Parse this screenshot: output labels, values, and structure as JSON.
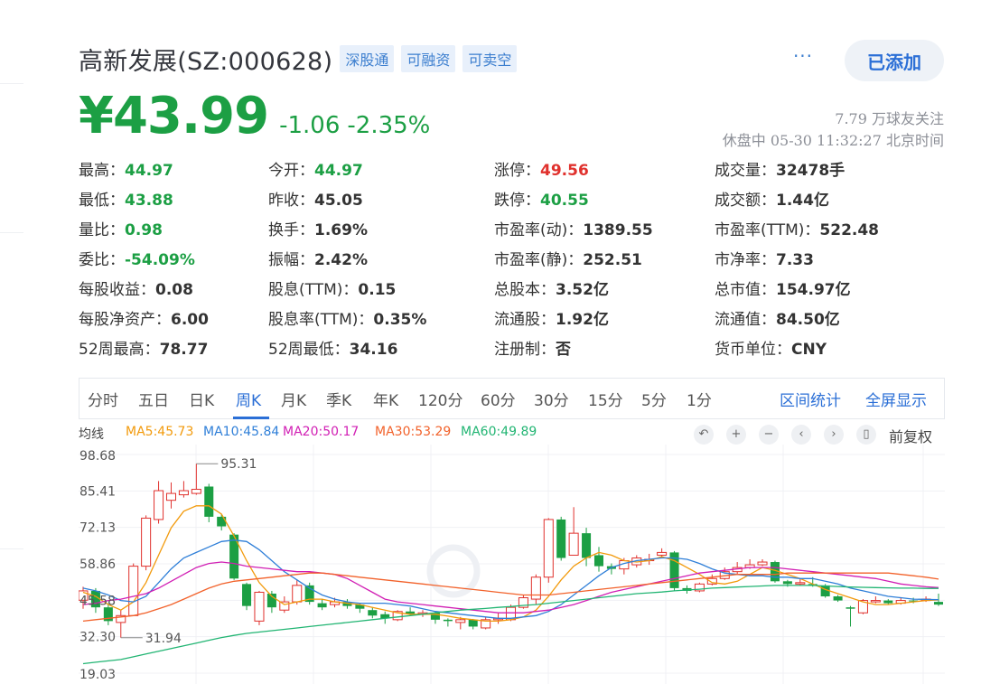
{
  "header": {
    "name": "高新发展(SZ:000628)",
    "tags": [
      "深股通",
      "可融资",
      "可卖空"
    ],
    "more_label": "···",
    "added_label": "已添加"
  },
  "price": {
    "current": "¥43.99",
    "change": "-1.06",
    "change_pct": "-2.35%",
    "followers": "7.79 万球友关注",
    "status": "休盘中 05-30 11:32:27 北京时间"
  },
  "quote": [
    [
      [
        "最高",
        "44.97",
        "green"
      ],
      [
        "今开",
        "44.97",
        "green"
      ],
      [
        "涨停",
        "49.56",
        "red"
      ],
      [
        "成交量",
        "32478手",
        ""
      ]
    ],
    [
      [
        "最低",
        "43.88",
        "green"
      ],
      [
        "昨收",
        "45.05",
        ""
      ],
      [
        "跌停",
        "40.55",
        "green"
      ],
      [
        "成交额",
        "1.44亿",
        ""
      ]
    ],
    [
      [
        "量比",
        "0.98",
        "green"
      ],
      [
        "换手",
        "1.69%",
        ""
      ],
      [
        "市盈率(动)",
        "1389.55",
        ""
      ],
      [
        "市盈率(TTM)",
        "522.48",
        ""
      ]
    ],
    [
      [
        "委比",
        "-54.09%",
        "green"
      ],
      [
        "振幅",
        "2.42%",
        ""
      ],
      [
        "市盈率(静)",
        "252.51",
        ""
      ],
      [
        "市净率",
        "7.33",
        ""
      ]
    ],
    [
      [
        "每股收益",
        "0.08",
        ""
      ],
      [
        "股息(TTM)",
        "0.15",
        ""
      ],
      [
        "总股本",
        "3.52亿",
        ""
      ],
      [
        "总市值",
        "154.97亿",
        ""
      ]
    ],
    [
      [
        "每股净资产",
        "6.00",
        ""
      ],
      [
        "股息率(TTM)",
        "0.35%",
        ""
      ],
      [
        "流通股",
        "1.92亿",
        ""
      ],
      [
        "流通值",
        "84.50亿",
        ""
      ]
    ],
    [
      [
        "52周最高",
        "78.77",
        ""
      ],
      [
        "52周最低",
        "34.16",
        ""
      ],
      [
        "注册制",
        "否",
        ""
      ],
      [
        "货币单位",
        "CNY",
        ""
      ]
    ]
  ],
  "periods": [
    "分时",
    "五日",
    "日K",
    "周K",
    "月K",
    "季K",
    "年K",
    "120分",
    "60分",
    "30分",
    "15分",
    "5分",
    "1分"
  ],
  "active_period": 3,
  "period_links": [
    "区间统计",
    "全屏显示"
  ],
  "ma": {
    "label": "均线",
    "items": [
      {
        "text": "MA5:45.73",
        "color": "#f29a0c"
      },
      {
        "text": "MA10:45.84",
        "color": "#2f7fd8"
      },
      {
        "text": "MA20:50.17",
        "color": "#d11fb4"
      },
      {
        "text": "MA30:53.29",
        "color": "#f2622b"
      },
      {
        "text": "MA60:49.89",
        "color": "#22b573"
      }
    ],
    "fuquan_label": "前复权"
  },
  "controls": [
    {
      "name": "undo-icon",
      "glyph": "↶"
    },
    {
      "name": "zoom-in-icon",
      "glyph": "+"
    },
    {
      "name": "zoom-out-icon",
      "glyph": "−"
    },
    {
      "name": "scroll-left-icon",
      "glyph": "‹"
    },
    {
      "name": "scroll-right-icon",
      "glyph": "›"
    },
    {
      "name": "candle-type-icon",
      "glyph": "▯"
    }
  ],
  "chart_data": {
    "type": "candlestick",
    "y_ticks": [
      "98.68",
      "85.41",
      "72.13",
      "58.86",
      "45.58",
      "32.30",
      "19.03"
    ],
    "y_tick_values": [
      98.68,
      85.41,
      72.13,
      58.86,
      45.58,
      32.3,
      19.03
    ],
    "ylim": [
      19.03,
      98.68
    ],
    "annotations": [
      {
        "text": "95.31",
        "value": 95.31,
        "index": 9
      },
      {
        "text": "31.94",
        "value": 31.94,
        "index": 3
      }
    ],
    "candles": [
      [
        45.6,
        49,
        50.5,
        42.5
      ],
      [
        49,
        43,
        50,
        41
      ],
      [
        43,
        38,
        44.5,
        36.5
      ],
      [
        37.5,
        40,
        42,
        31.94
      ],
      [
        40,
        58,
        59,
        40
      ],
      [
        58,
        75.5,
        76.5,
        56.5
      ],
      [
        75,
        85.5,
        89,
        73.5
      ],
      [
        82,
        84.5,
        88.5,
        79
      ],
      [
        84,
        85.5,
        89,
        83
      ],
      [
        84.5,
        86,
        95.31,
        84
      ],
      [
        87,
        76,
        88,
        74
      ],
      [
        76,
        72.5,
        77,
        71
      ],
      [
        69.5,
        53.5,
        70,
        53
      ],
      [
        51.5,
        43.5,
        52,
        42
      ],
      [
        38,
        48.5,
        49,
        36.5
      ],
      [
        48,
        43,
        49,
        41
      ],
      [
        42,
        45,
        47,
        41
      ],
      [
        45,
        51,
        53,
        44
      ],
      [
        51,
        45,
        52,
        44
      ],
      [
        44.5,
        43,
        46,
        42
      ],
      [
        44,
        45,
        46.5,
        43
      ],
      [
        45,
        43.5,
        46,
        42.5
      ],
      [
        44,
        42.5,
        44.5,
        41
      ],
      [
        42,
        40,
        43,
        39
      ],
      [
        40.5,
        39,
        41.5,
        37
      ],
      [
        38.5,
        41.5,
        42,
        38
      ],
      [
        41.5,
        40.5,
        43,
        40
      ],
      [
        40.5,
        41,
        42,
        39.5
      ],
      [
        41,
        38.5,
        41.5,
        37
      ],
      [
        38.5,
        38,
        39,
        36
      ],
      [
        37.5,
        38.5,
        39.5,
        35
      ],
      [
        38.5,
        36,
        38.8,
        35
      ],
      [
        35.5,
        38.5,
        39.5,
        35
      ],
      [
        38.5,
        39,
        41,
        37
      ],
      [
        38.5,
        43,
        44,
        38
      ],
      [
        43,
        46.5,
        47.5,
        42.5
      ],
      [
        46,
        54,
        55,
        44
      ],
      [
        54,
        75,
        75.5,
        52
      ],
      [
        75,
        61,
        76,
        60
      ],
      [
        62,
        70,
        79.5,
        62
      ],
      [
        70,
        61,
        72,
        58
      ],
      [
        62,
        58,
        65,
        56
      ],
      [
        58,
        57,
        59,
        55
      ],
      [
        57,
        60,
        61,
        55
      ],
      [
        58.5,
        61,
        62,
        57.5
      ],
      [
        60,
        60.5,
        62.5,
        58.5
      ],
      [
        62,
        63,
        64.5,
        61
      ],
      [
        63,
        50,
        63.5,
        49
      ],
      [
        50,
        49,
        51,
        48
      ],
      [
        49,
        51.5,
        52,
        48.5
      ],
      [
        51.5,
        53.5,
        55,
        51
      ],
      [
        53.5,
        56,
        57.5,
        53
      ],
      [
        56,
        57.5,
        59.5,
        55
      ],
      [
        57.5,
        58.5,
        60.5,
        57
      ],
      [
        58.5,
        59.5,
        60.5,
        58
      ],
      [
        59.5,
        52.5,
        60,
        52
      ],
      [
        52.5,
        51.5,
        53,
        50.5
      ],
      [
        51.5,
        52,
        53.5,
        51
      ],
      [
        51.5,
        51,
        54,
        50.5
      ],
      [
        51,
        47,
        51.5,
        46.5
      ],
      [
        47,
        45.5,
        47.5,
        45
      ],
      [
        43,
        42.5,
        43.5,
        36
      ],
      [
        41,
        45.5,
        46,
        40.5
      ],
      [
        45,
        45.5,
        47,
        44.5
      ],
      [
        45.5,
        44.5,
        46,
        44
      ],
      [
        44.5,
        45.5,
        46.5,
        44
      ],
      [
        45.5,
        45.3,
        46.5,
        44.5
      ],
      [
        45.5,
        46,
        47,
        45
      ],
      [
        45,
        44,
        48,
        43.5
      ]
    ],
    "ma_lines": {
      "MA5": [
        48.5,
        47,
        44,
        42,
        45,
        52,
        62,
        72,
        78,
        80,
        80,
        77,
        69,
        60,
        52,
        47,
        44,
        45,
        46,
        46,
        45,
        44.5,
        44,
        43,
        42,
        41,
        40.5,
        40.5,
        40.5,
        39.8,
        39,
        38.5,
        38,
        38,
        38.5,
        39.5,
        42,
        47,
        53,
        58,
        61,
        63,
        62,
        60,
        59.5,
        60,
        61.5,
        60,
        57.5,
        55,
        52,
        51.5,
        52.5,
        55,
        57.5,
        56.5,
        55,
        53.5,
        51.5,
        49.5,
        48,
        46.5,
        45,
        44,
        44,
        44.5,
        45,
        45.5,
        45.7
      ],
      "MA10": [
        50,
        49,
        47.5,
        45.5,
        45,
        47,
        52,
        57,
        61,
        63,
        65,
        67,
        67.5,
        67,
        64,
        60,
        56,
        53,
        50,
        47.5,
        46,
        45,
        44.5,
        44.5,
        44.5,
        44,
        43.5,
        42.5,
        41.5,
        41,
        40.5,
        40,
        39.5,
        39,
        39,
        39.5,
        40,
        41.5,
        44,
        47.5,
        51,
        54.5,
        57.5,
        59,
        60,
        60.5,
        61,
        61,
        60.5,
        59,
        57,
        55.5,
        55,
        54.5,
        54.5,
        54,
        54,
        53.5,
        53.5,
        52.5,
        51.5,
        50,
        49,
        48,
        47,
        46.5,
        46,
        45.9,
        45.8
      ],
      "MA20": [
        44,
        44.5,
        45.5,
        46,
        47,
        48,
        50,
        52.5,
        55,
        57.5,
        59,
        59.5,
        59,
        58,
        57.5,
        57,
        56.5,
        56,
        56,
        55.5,
        55,
        53.5,
        51,
        48.5,
        46,
        45,
        44.5,
        44,
        43.5,
        43,
        42.5,
        42,
        41.5,
        41,
        41,
        41,
        41.5,
        42,
        43,
        44,
        45.5,
        47,
        48.5,
        49.5,
        50.5,
        51.5,
        52.5,
        53.5,
        54.5,
        55.5,
        56,
        56.5,
        57,
        57.5,
        57.5,
        57.5,
        57,
        56.5,
        56,
        55.5,
        55,
        54.5,
        54,
        53.5,
        52.5,
        51.5,
        51,
        50.5,
        50.2
      ],
      "MA30": [
        38,
        38.5,
        39,
        39.5,
        40,
        41,
        42.5,
        44,
        46,
        48,
        50,
        51.5,
        52.5,
        53,
        53.5,
        54,
        54.5,
        55,
        55.5,
        55.5,
        55,
        54.5,
        54,
        53.5,
        53,
        52.5,
        52,
        51.5,
        51,
        50.5,
        50,
        49.5,
        49,
        48.5,
        48,
        47.5,
        47.5,
        47.5,
        48,
        48.5,
        49,
        49.5,
        50,
        50.5,
        51,
        51.5,
        52,
        52.5,
        53,
        53.5,
        54,
        54.5,
        55,
        55,
        55,
        55,
        55.5,
        55.5,
        55.5,
        55.5,
        55.5,
        55.5,
        55.5,
        55.5,
        55.5,
        55,
        54.5,
        54,
        53.3
      ],
      "MA60": [
        22.5,
        23,
        23.5,
        24,
        25,
        26,
        27,
        28,
        29,
        30,
        31,
        32,
        32.8,
        33.5,
        34,
        34.5,
        35,
        35.5,
        36,
        36.5,
        37,
        37.5,
        38,
        38.5,
        39,
        39.5,
        40,
        40.5,
        41,
        41.5,
        42,
        42.3,
        42.6,
        43,
        43.3,
        43.7,
        44,
        44.5,
        45,
        45.5,
        46,
        46.5,
        47,
        47.5,
        48,
        48.3,
        48.6,
        49,
        49.3,
        49.6,
        50,
        50.2,
        50.4,
        50.6,
        50.8,
        51,
        51,
        51,
        51,
        50.8,
        50.6,
        50.4,
        50.3,
        50.2,
        50.1,
        50,
        50,
        49.9,
        49.9
      ]
    },
    "up_color": "#e0312d",
    "down_color": "#1c9f44"
  }
}
